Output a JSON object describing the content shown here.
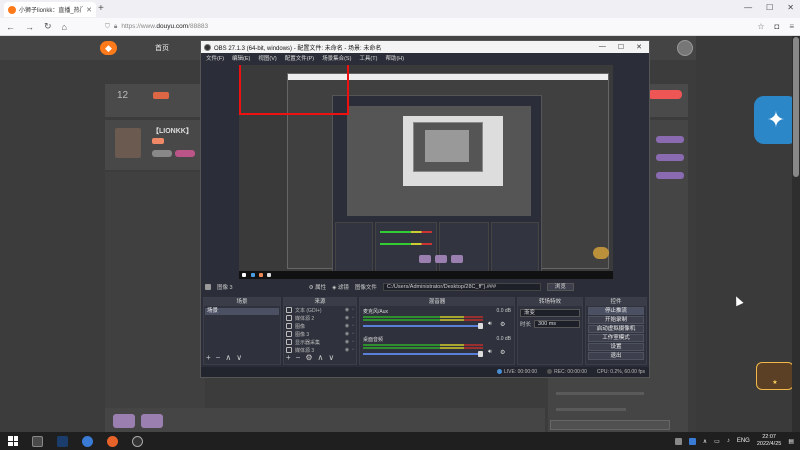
{
  "browser": {
    "tab_title": "小狮子lionkk：直播_热门游戏",
    "url_prefix": "https://www.",
    "url_domain": "douyu.com",
    "url_path": "/88883"
  },
  "douyu": {
    "home": "首页",
    "count": "12",
    "streamer_name": "【LIONKK】"
  },
  "obs": {
    "title": "OBS 27.1.3 (64-bit, windows) - 配置文件: 未命名 - 场景: 未命名",
    "menu": [
      "文件(F)",
      "编辑(E)",
      "视图(V)",
      "配置文件(P)",
      "场景集合(S)",
      "工具(T)",
      "帮助(H)"
    ],
    "source_bar": {
      "selected_source": "图像 3",
      "properties_label": "属性",
      "filters_label": "滤镜",
      "image_file_label": "图像文件",
      "path": "C:/Users/Administrator/Desktop/28C_ff\"}.###",
      "browse_label": "浏览"
    },
    "docks": {
      "scenes": {
        "title": "场景",
        "items": [
          "场景"
        ]
      },
      "sources": {
        "title": "来源",
        "items": [
          "文本 (GDI+)",
          "媒体源 2",
          "图像",
          "图像 3",
          "显示器采集",
          "媒体源 3"
        ]
      },
      "mixer": {
        "title": "混音器",
        "channels": [
          {
            "name": "麦克风/Aux",
            "db": "0.0 dB"
          },
          {
            "name": "桌面音频",
            "db": "0.0 dB"
          }
        ]
      },
      "transitions": {
        "title": "转场特效",
        "selected": "渐变",
        "duration_label": "时长",
        "duration_value": "300 ms"
      },
      "controls": {
        "title": "控件",
        "buttons": [
          "停止推流",
          "开始录制",
          "启动虚拟摄像机",
          "工作室模式",
          "设置",
          "退出"
        ]
      }
    },
    "status": {
      "live": "LIVE: 00:00:00",
      "rec": "REC: 00:00:00",
      "cpu": "CPU: 0.2%, 60.00 fps"
    }
  },
  "taskbar": {
    "lang": "ENG",
    "time": "22:07",
    "date": "2022/4/25"
  }
}
